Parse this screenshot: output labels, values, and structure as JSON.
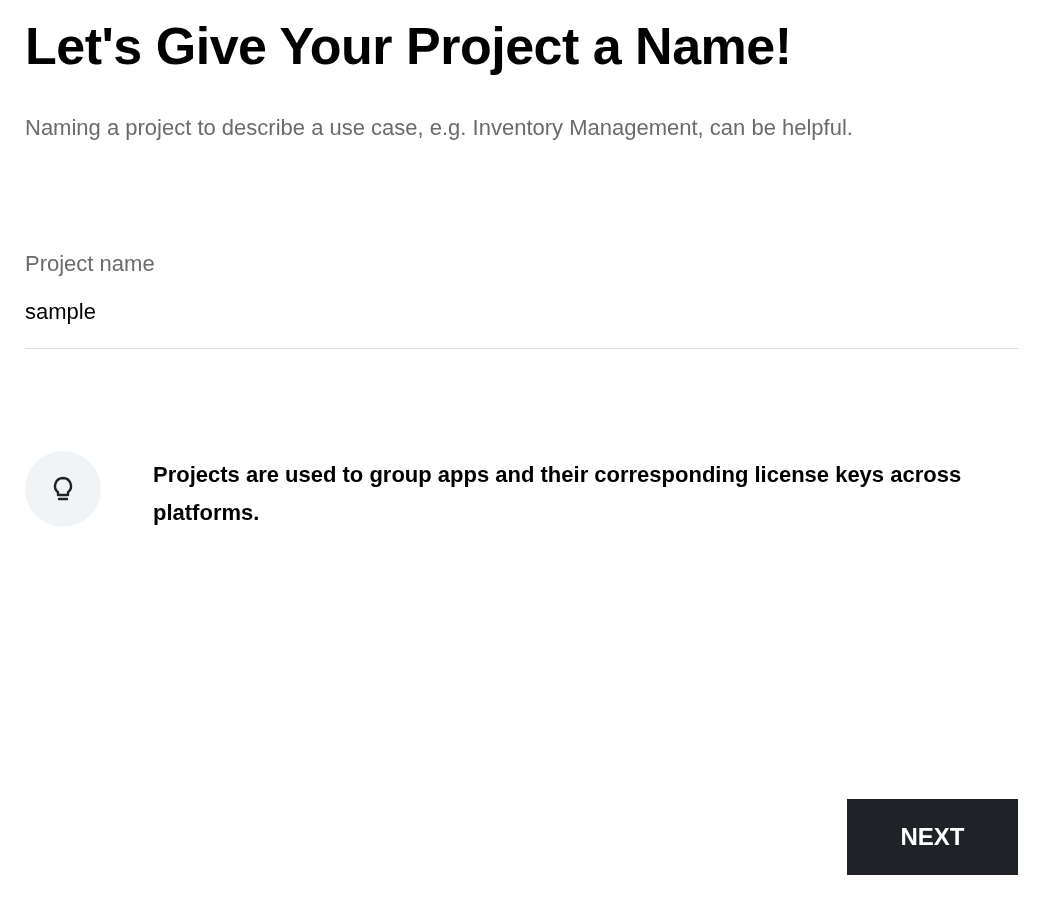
{
  "title": "Let's Give Your Project a Name!",
  "subtitle": "Naming a project to describe a use case, e.g. Inventory Management, can be helpful.",
  "project_name_field": {
    "label": "Project name",
    "value": "sample"
  },
  "tip": {
    "text": "Projects are used to group apps and their corresponding license keys across platforms."
  },
  "buttons": [
    {
      "label": "NEXT"
    }
  ]
}
